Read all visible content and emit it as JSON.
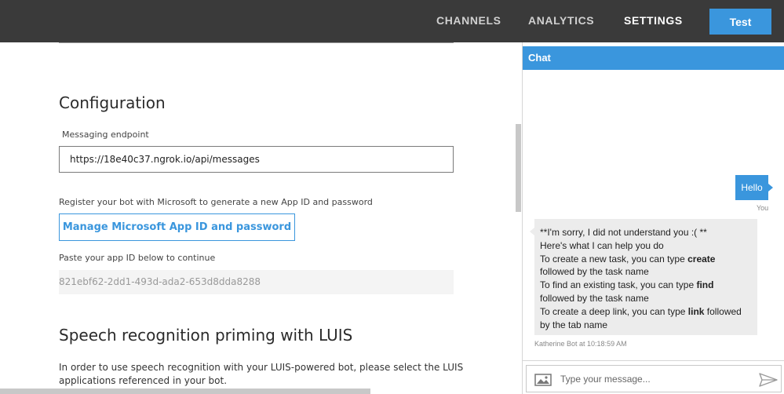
{
  "nav": {
    "items": [
      {
        "label": "CHANNELS",
        "active": false
      },
      {
        "label": "ANALYTICS",
        "active": false
      },
      {
        "label": "SETTINGS",
        "active": true
      }
    ],
    "test_label": "Test"
  },
  "settings": {
    "configuration": {
      "heading": "Configuration",
      "endpoint_label": "Messaging endpoint",
      "endpoint_value": "https://18e40c37.ngrok.io/api/messages",
      "register_text": "Register your bot with Microsoft to generate a new App ID and password",
      "manage_button": "Manage Microsoft App ID and password",
      "paste_label": "Paste your app ID below to continue",
      "app_id": "821ebf62-2dd1-493d-ada2-653d8dda8288"
    },
    "luis": {
      "heading": "Speech recognition priming with LUIS",
      "text": "In order to use speech recognition with your LUIS-powered bot, please select the LUIS applications referenced in your bot."
    }
  },
  "chat": {
    "header": "Chat",
    "user_message": "Hello",
    "user_meta": "You",
    "bot_message": [
      [
        {
          "t": "**I'm sorry, I did not understand you :( **"
        }
      ],
      [
        {
          "t": "Here's what I can help you do"
        }
      ],
      [
        {
          "t": "To create a new task, you can type "
        },
        {
          "t": "create",
          "b": true
        }
      ],
      [
        {
          "t": "followed by the task name"
        }
      ],
      [
        {
          "t": "To find an existing task, you can type "
        },
        {
          "t": "find",
          "b": true
        }
      ],
      [
        {
          "t": "followed by the task name"
        }
      ],
      [
        {
          "t": "To create a deep link, you can type "
        },
        {
          "t": "link",
          "b": true
        },
        {
          "t": " followed"
        }
      ],
      [
        {
          "t": "by the tab name"
        }
      ]
    ],
    "bot_meta": "Katherine Bot at 10:18:59 AM",
    "input_placeholder": "Type your message...",
    "colors": {
      "accent": "#3a96dd",
      "bot_bubble": "#ececec",
      "nav_bg": "#3a3a3a"
    }
  }
}
